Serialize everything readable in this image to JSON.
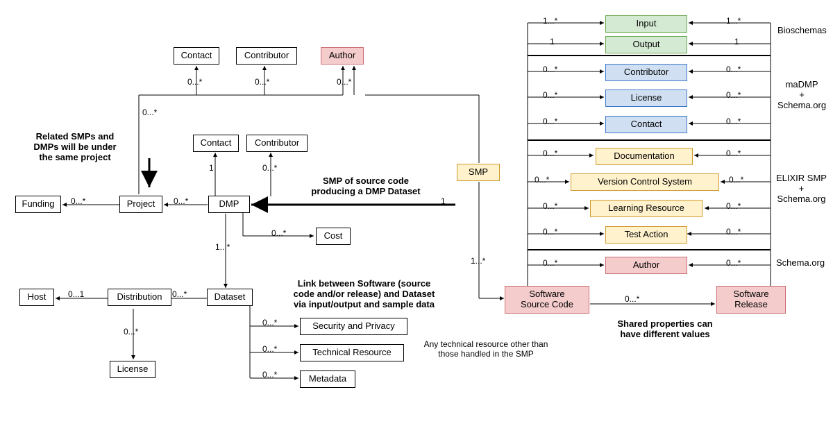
{
  "nodes": {
    "contact1": "Contact",
    "contributor1": "Contributor",
    "author": "Author",
    "contact2": "Contact",
    "contributor2": "Contributor",
    "smp": "SMP",
    "funding": "Funding",
    "project": "Project",
    "dmp": "DMP",
    "cost": "Cost",
    "dataset": "Dataset",
    "host": "Host",
    "distribution": "Distribution",
    "license": "License",
    "security": "Security and Privacy",
    "techres": "Technical Resource",
    "metadata": "Metadata",
    "input": "Input",
    "output": "Output",
    "contributor_r": "Contributor",
    "license_r": "License",
    "contact_r": "Contact",
    "doc": "Documentation",
    "vcs": "Version Control System",
    "learn": "Learning Resource",
    "testa": "Test Action",
    "author_r": "Author",
    "ssc": "Software\nSource Code",
    "srel": "Software\nRelease"
  },
  "texts": {
    "related": "Related SMPs and\nDMPs will be under\nthe same project",
    "smpsrc": "SMP of source code\nproducing a  DMP Dataset",
    "linksw": "Link between Software (source\ncode and/or release) and Dataset\nvia input/output and sample data",
    "anytech": "Any technical resource other than\nthose handled in the SMP",
    "bio": "Bioschemas",
    "madmp": "maDMP\n+\nSchema.org",
    "elixir": "ELIXIR SMP\n+\nSchema.org",
    "schemaorg": "Schema.org",
    "shared": "Shared properties can\nhave different values"
  },
  "mults": {
    "m0s": "0...*",
    "m1s": "1...*",
    "m01": "0...1",
    "m1": "1"
  }
}
